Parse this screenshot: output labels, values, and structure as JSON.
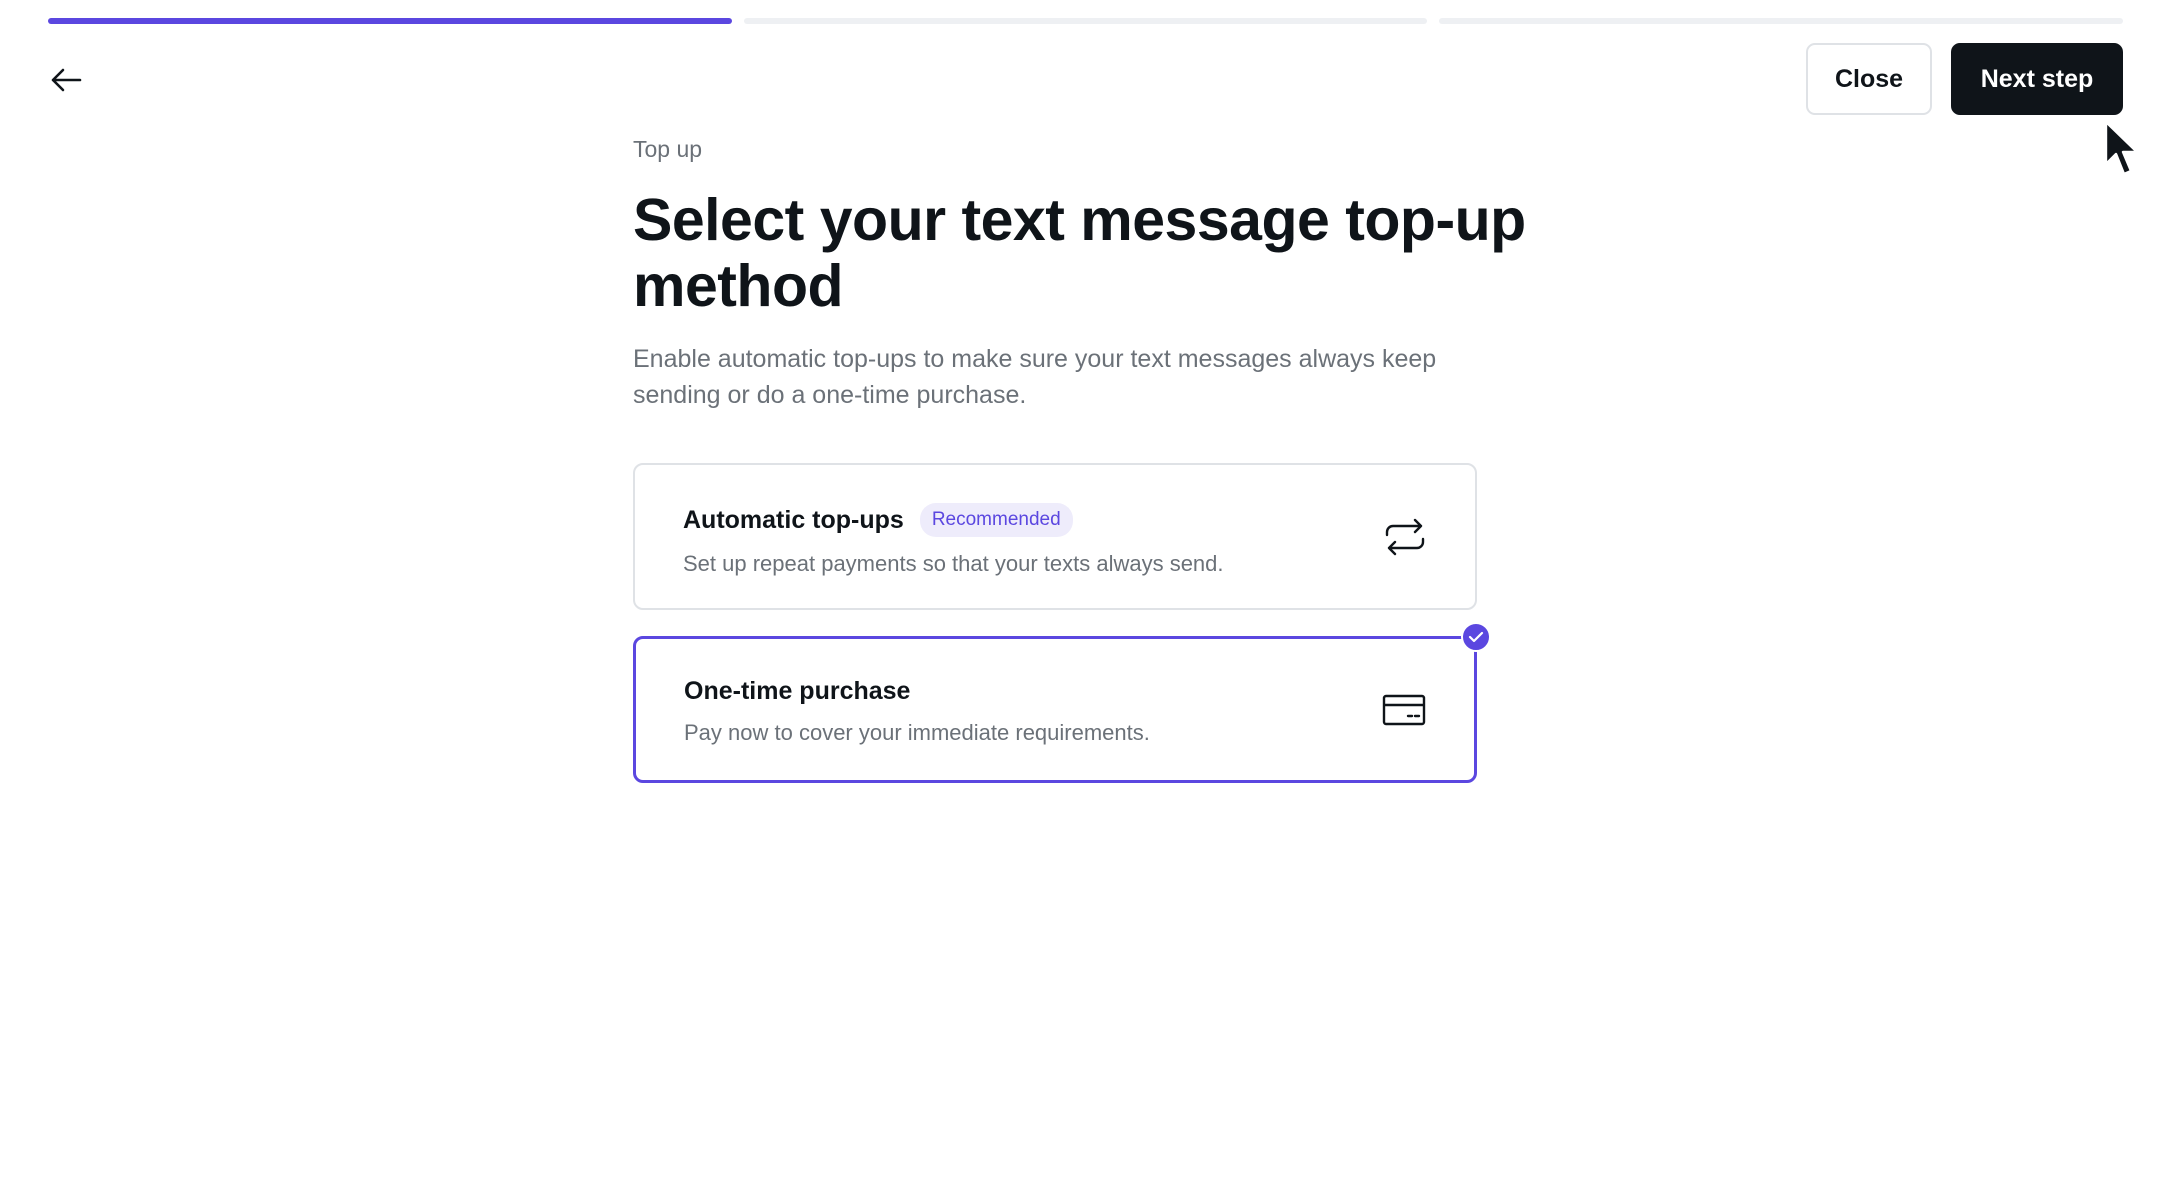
{
  "progress": {
    "total_steps": 3,
    "current_step": 1
  },
  "header": {
    "back_icon": "arrow-left-icon",
    "close_label": "Close",
    "next_label": "Next step"
  },
  "page": {
    "eyebrow": "Top up",
    "title": "Select your text message top-up method",
    "subtitle": "Enable automatic top-ups to make sure your text messages always keep sending or do a one-time purchase."
  },
  "options": [
    {
      "title": "Automatic top-ups",
      "badge": "Recommended",
      "description": "Set up repeat payments so that your texts always send.",
      "icon": "repeat-icon",
      "selected": false
    },
    {
      "title": "One-time purchase",
      "description": "Pay now to cover your immediate requirements.",
      "icon": "credit-card-icon",
      "selected": true
    }
  ],
  "colors": {
    "accent": "#5b47e0",
    "primary": "#0f1419",
    "muted": "#6b7178",
    "border": "#dfe2e6"
  }
}
